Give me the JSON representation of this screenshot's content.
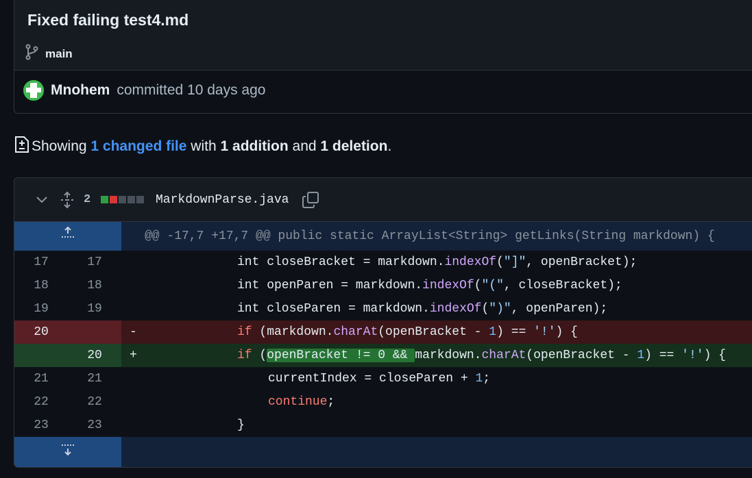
{
  "commit": {
    "title": "Fixed failing test4.md",
    "branch": "main",
    "author": "Mnohem",
    "action_text": "committed 10 days ago"
  },
  "summary": {
    "prefix": "Showing",
    "changed_files": "1 changed file",
    "with": "with",
    "additions": "1 addition",
    "and": "and",
    "deletions": "1 deletion",
    "period": "."
  },
  "file": {
    "diffstat": "2",
    "name": "MarkdownParse.java",
    "hunk_header": "@@ -17,7 +17,7 @@ public static ArrayList<String> getLinks(String markdown) {"
  },
  "diff_lines": [
    {
      "old": "17",
      "new": "17",
      "marker": "",
      "type": "ctx"
    },
    {
      "old": "18",
      "new": "18",
      "marker": "",
      "type": "ctx"
    },
    {
      "old": "19",
      "new": "19",
      "marker": "",
      "type": "ctx"
    },
    {
      "old": "20",
      "new": "",
      "marker": "-",
      "type": "del"
    },
    {
      "old": "",
      "new": "20",
      "marker": "+",
      "type": "add"
    },
    {
      "old": "21",
      "new": "21",
      "marker": "",
      "type": "ctx"
    },
    {
      "old": "22",
      "new": "22",
      "marker": "",
      "type": "ctx"
    },
    {
      "old": "23",
      "new": "23",
      "marker": "",
      "type": "ctx"
    }
  ],
  "code": {
    "l17": {
      "a": "int closeBracket = markdown.",
      "fn": "indexOf",
      "b": "(",
      "s": "\"]\"",
      "c": ", openBracket);"
    },
    "l18": {
      "a": "int openParen = markdown.",
      "fn": "indexOf",
      "b": "(",
      "s": "\"(\"",
      "c": ", closeBracket);"
    },
    "l19": {
      "a": "int closeParen = markdown.",
      "fn": "indexOf",
      "b": "(",
      "s": "\")\"",
      "c": ", openParen);"
    },
    "del": {
      "kw": "if",
      "a": " (markdown.",
      "fn": "charAt",
      "b": "(openBracket - ",
      "n": "1",
      "c": ") == ",
      "s": "'!'",
      "d": ") {"
    },
    "add": {
      "kw": "if",
      "a": " (",
      "hl": "openBracket != 0 && ",
      "b": "markdown.",
      "fn": "charAt",
      "c": "(openBracket - ",
      "n": "1",
      "d": ") == ",
      "s": "'!'",
      "e": ") {"
    },
    "l21": {
      "a": "currentIndex = closeParen + ",
      "n": "1",
      "b": ";"
    },
    "l22": {
      "kw": "continue",
      "a": ";"
    },
    "l23": {
      "a": "}"
    }
  },
  "colors": {
    "expander_bg": "#1f4a80",
    "hunk_bg": "#132139",
    "del_line_bg": "#5a1f25",
    "del_code_bg": "#3c1618",
    "add_line_bg": "#1d4428",
    "add_code_bg": "#15301d",
    "stat_green": "#2ea043",
    "stat_red": "#da3633",
    "stat_gray": "#484f58"
  }
}
